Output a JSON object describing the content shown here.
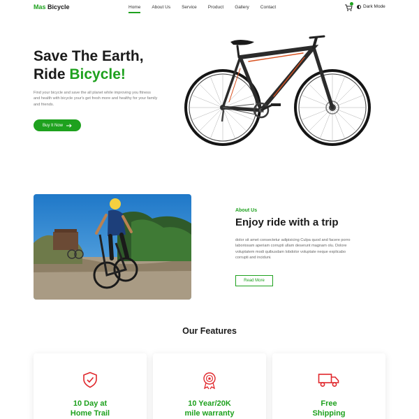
{
  "nav": {
    "logo_part1": "Mas",
    "logo_part2": "Bicycle",
    "items": [
      {
        "label": "Home"
      },
      {
        "label": "About Us"
      },
      {
        "label": "Service"
      },
      {
        "label": "Product"
      },
      {
        "label": "Gallery"
      },
      {
        "label": "Contact"
      }
    ],
    "active_item": "Home",
    "cart_icon": "cart-icon",
    "dark_mode_label": "Dark Mode"
  },
  "hero": {
    "title_line1": "Save The Earth,",
    "title_line2_prefix": "Ride ",
    "title_line2_highlight": "Bicycle!",
    "description": "Find your bicycle and save the all planet while improving you fitness and health with bicycle your's get fresh more and healthy for your family and friends.",
    "cta_label": "Buy It Now",
    "cta_icon": "arrow-right-icon"
  },
  "about": {
    "kicker": "About Us",
    "title": "Enjoy ride with a trip",
    "text": "dolor sit amet consectetur adipisicing Culpa quod and facere porro laboriosam aperiam corrupti ullam deserunt magnam olu. Dolore voluptatem modi quibusdam lobdolor voluptate neque explicabo corrupti and inciduni.",
    "button_label": "Read More"
  },
  "features": {
    "title": "Our Features",
    "cards": [
      {
        "label": "10 Day at\nHome Trail",
        "icon": "shield-check-icon"
      },
      {
        "label": "10 Year/20K\nmile warranty",
        "icon": "award-badge-icon"
      },
      {
        "label": "Free\nShipping",
        "icon": "truck-icon"
      }
    ]
  },
  "colors": {
    "accent": "#1ea11e",
    "icon_red": "#e0262b",
    "text_dark": "#1a1a1a"
  }
}
